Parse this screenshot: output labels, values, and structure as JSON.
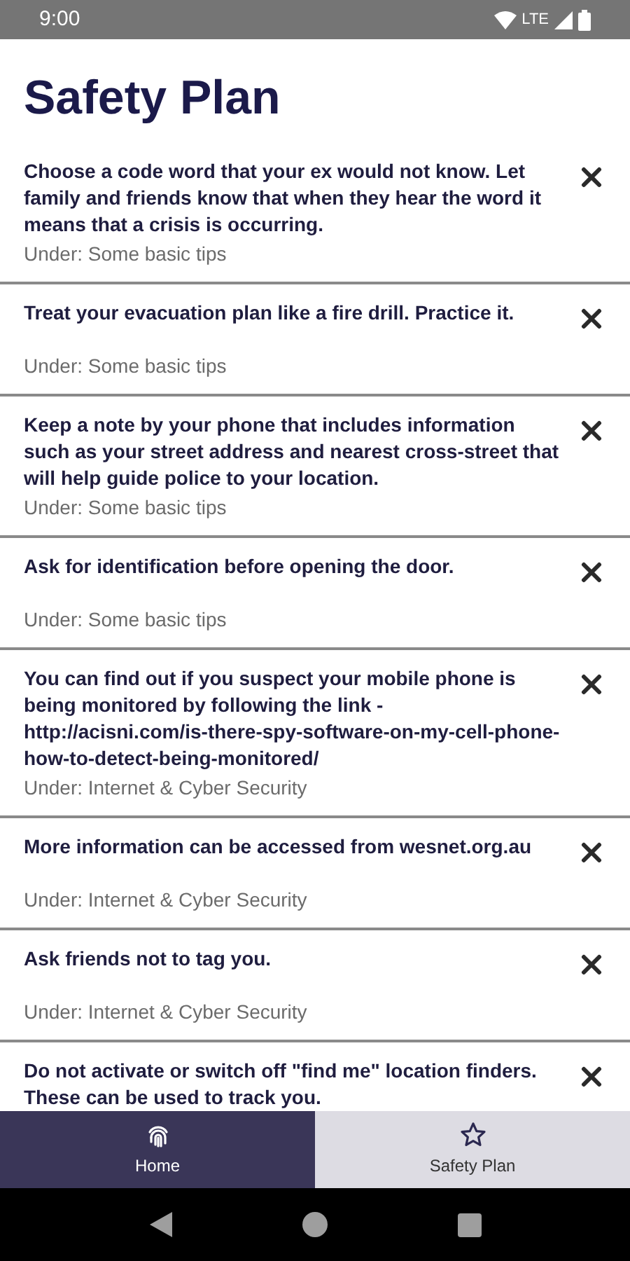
{
  "status_bar": {
    "time": "9:00",
    "network": "LTE"
  },
  "title": "Safety Plan",
  "items": [
    {
      "text": "Choose a code word that your ex would not know. Let family and friends know that when they hear the word it means that a crisis is occurring.",
      "category": "Under: Some basic tips"
    },
    {
      "text": "Treat your evacuation plan like a fire drill. Practice it.",
      "category": "Under: Some basic tips"
    },
    {
      "text": "Keep a note by your phone that includes information such as your street address and nearest cross-street that will help guide police to your location.",
      "category": "Under: Some basic tips"
    },
    {
      "text": "Ask for identification before opening the door.",
      "category": "Under: Some basic tips"
    },
    {
      "text": "You can find out if you suspect your mobile phone is being monitored by following the link - http://acisni.com/is-there-spy-software-on-my-cell-phone-how-to-detect-being-monitored/",
      "category": "Under: Internet & Cyber Security"
    },
    {
      "text": "More information can be accessed from wesnet.org.au",
      "category": "Under: Internet & Cyber Security"
    },
    {
      "text": "Ask friends not to tag you.",
      "category": "Under: Internet & Cyber Security"
    },
    {
      "text": "Do not activate or switch off \"find me\" location finders. These can be used to track you."
    }
  ],
  "tabs": [
    {
      "label": "Home",
      "selected": true
    },
    {
      "label": "Safety Plan",
      "selected": false
    }
  ]
}
